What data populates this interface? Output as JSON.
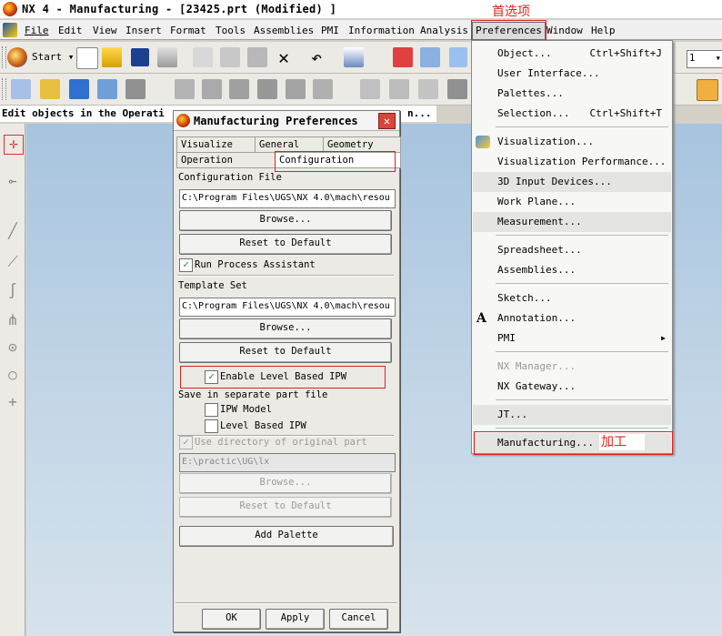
{
  "window": {
    "title": "NX 4 - Manufacturing - [23425.prt (Modified) ]"
  },
  "menubar": {
    "items": [
      "File",
      "Edit",
      "View",
      "Insert",
      "Format",
      "Tools",
      "Assemblies",
      "PMI",
      "Information",
      "Analysis",
      "Preferences",
      "Window",
      "Help"
    ],
    "active": "Preferences"
  },
  "toolbar": {
    "start_label": "Start",
    "combo_value": "1"
  },
  "statusline": {
    "text": "Edit objects in the Operati",
    "tail": "n..."
  },
  "annotations": {
    "preferences_note": "首选项",
    "manufacturing_note": "加工"
  },
  "dialog": {
    "title": "Manufacturing Preferences",
    "close_glyph": "✕",
    "tabs": [
      "Visualize",
      "General",
      "Geometry",
      "Operation",
      "Configuration"
    ],
    "selected_tab": "Configuration",
    "config_file_label": "Configuration File",
    "config_file_value": "C:\\Program Files\\UGS\\NX 4.0\\mach\\resou",
    "browse_label": "Browse...",
    "reset_label": "Reset to Default",
    "run_process_assistant": "Run Process Assistant",
    "template_set_label": "Template Set",
    "template_set_value": "C:\\Program Files\\UGS\\NX 4.0\\mach\\resou",
    "enable_ipw": "Enable Level Based IPW",
    "save_separate_label": "Save in separate part file",
    "ipw_model": "IPW Model",
    "level_based_ipw": "Level Based IPW",
    "use_directory": "Use directory of original part",
    "directory_value": "E:\\practic\\UG\\lx",
    "add_palette": "Add Palette",
    "ok": "OK",
    "apply": "Apply",
    "cancel": "Cancel",
    "check_glyph": "✓"
  },
  "preferences_menu": {
    "items": [
      {
        "label": "Object...",
        "shortcut": "Ctrl+Shift+J"
      },
      {
        "label": "User Interface..."
      },
      {
        "label": "Palettes..."
      },
      {
        "label": "Selection...",
        "shortcut": "Ctrl+Shift+T"
      },
      {
        "label": "Visualization..."
      },
      {
        "label": "Visualization Performance..."
      },
      {
        "label": "3D Input Devices..."
      },
      {
        "label": "Work Plane..."
      },
      {
        "label": "Measurement..."
      },
      {
        "label": "Spreadsheet..."
      },
      {
        "label": "Assemblies..."
      },
      {
        "label": "Sketch..."
      },
      {
        "label": "Annotation..."
      },
      {
        "label": "PMI"
      },
      {
        "label": "NX Manager..."
      },
      {
        "label": "NX Gateway..."
      },
      {
        "label": "JT..."
      },
      {
        "label": "Manufacturing..."
      }
    ],
    "submenu_arrow": "▶"
  }
}
